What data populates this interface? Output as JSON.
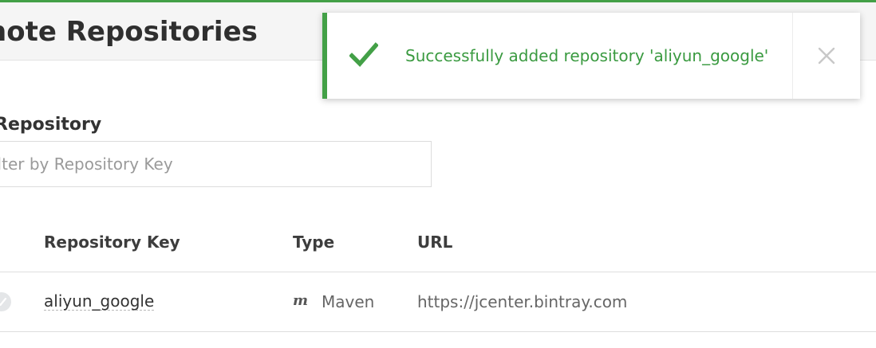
{
  "header": {
    "title": "note Repositories"
  },
  "filter": {
    "label": "Repository",
    "placeholder": "ilter by Repository Key"
  },
  "table": {
    "columns": [
      "Repository Key",
      "Type",
      "URL"
    ],
    "rows": [
      {
        "key": "aliyun_google",
        "type_icon": "m",
        "type": "Maven",
        "url": "https://jcenter.bintray.com"
      }
    ]
  },
  "toast": {
    "message": "Successfully added repository 'aliyun_google'",
    "icon": "check-icon",
    "close_icon": "close-icon"
  },
  "colors": {
    "success": "#43a047",
    "success_text": "#3a9a40"
  }
}
